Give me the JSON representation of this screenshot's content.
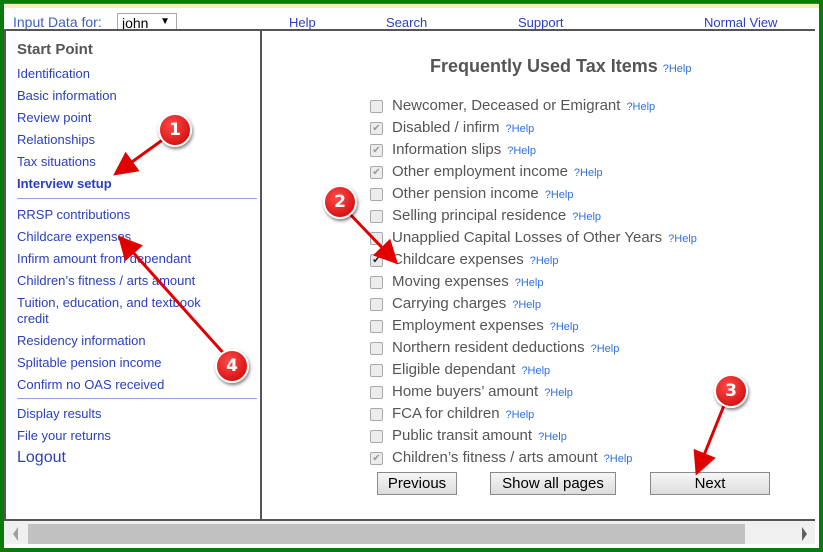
{
  "toolbar": {
    "input_label": "Input Data for:",
    "user_select": "john",
    "links": [
      "Help",
      "Search",
      "Support",
      "Normal View"
    ]
  },
  "sidebar": {
    "title": "Start Point",
    "group1": [
      "Identification",
      "Basic information",
      "Review point",
      "Relationships",
      "Tax situations",
      "Interview setup"
    ],
    "group2": [
      "RRSP contributions",
      "Childcare expenses",
      "Infirm amount from dependant",
      "Children’s fitness / arts amount",
      "Tuition, education, and textbook credit",
      "Residency information",
      "Splitable pension income",
      "Confirm no OAS received"
    ],
    "group3": [
      "Display results",
      "File your returns"
    ],
    "logout": "Logout"
  },
  "main": {
    "title": "Frequently Used Tax Items",
    "help_label": "?Help",
    "items": [
      {
        "label": "Newcomer, Deceased or Emigrant",
        "checked": false,
        "disabled": false
      },
      {
        "label": "Disabled / infirm",
        "checked": true,
        "disabled": true
      },
      {
        "label": "Information slips",
        "checked": true,
        "disabled": true
      },
      {
        "label": "Other employment income",
        "checked": true,
        "disabled": true
      },
      {
        "label": "Other pension income",
        "checked": false,
        "disabled": false
      },
      {
        "label": "Selling principal residence",
        "checked": false,
        "disabled": false
      },
      {
        "label": "Unapplied Capital Losses of Other Years",
        "checked": false,
        "disabled": false
      },
      {
        "label": "Childcare expenses",
        "checked": true,
        "disabled": false
      },
      {
        "label": "Moving expenses",
        "checked": false,
        "disabled": false
      },
      {
        "label": "Carrying charges",
        "checked": false,
        "disabled": false
      },
      {
        "label": "Employment expenses",
        "checked": false,
        "disabled": false
      },
      {
        "label": "Northern resident deductions",
        "checked": false,
        "disabled": false
      },
      {
        "label": "Eligible dependant",
        "checked": false,
        "disabled": false
      },
      {
        "label": "Home buyers’ amount",
        "checked": false,
        "disabled": false
      },
      {
        "label": "FCA for children",
        "checked": false,
        "disabled": false
      },
      {
        "label": "Public transit amount",
        "checked": false,
        "disabled": false
      },
      {
        "label": "Children’s fitness / arts amount",
        "checked": true,
        "disabled": true
      }
    ],
    "buttons": {
      "previous": "Previous",
      "show_all": "Show all pages",
      "next": "Next"
    }
  },
  "annotations": [
    "1",
    "2",
    "3",
    "4"
  ],
  "colors": {
    "frame": "#0a7a0a",
    "link": "#2a3fbf",
    "badge": "#d40000"
  }
}
